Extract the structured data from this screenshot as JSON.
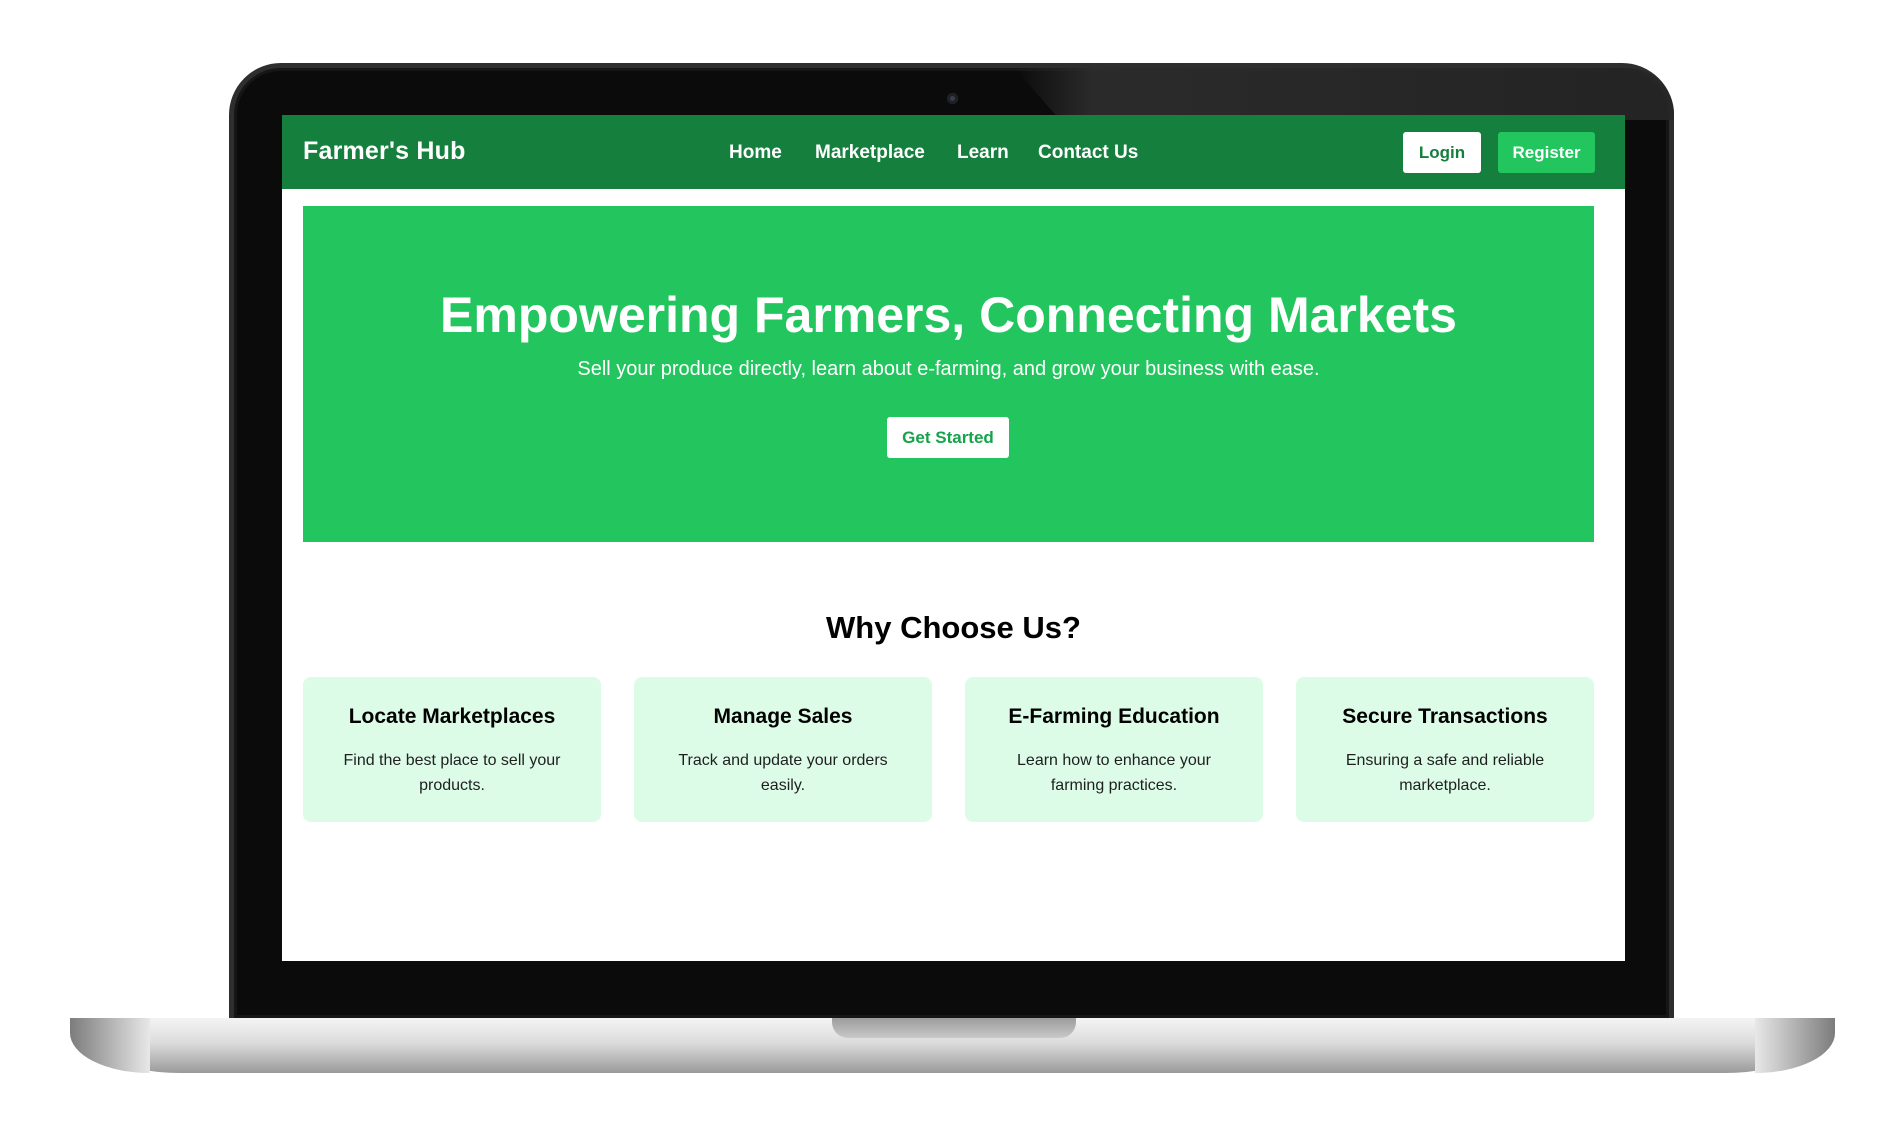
{
  "navbar": {
    "brand": "Farmer's Hub",
    "links": [
      {
        "label": "Home"
      },
      {
        "label": "Marketplace"
      },
      {
        "label": "Learn"
      },
      {
        "label": "Contact Us"
      }
    ],
    "login_label": "Login",
    "register_label": "Register"
  },
  "hero": {
    "title": "Empowering Farmers, Connecting Markets",
    "subtitle": "Sell your produce directly, learn about e-farming, and grow your business with ease.",
    "cta_label": "Get Started"
  },
  "features": {
    "heading": "Why Choose Us?",
    "cards": [
      {
        "title": "Locate Marketplaces",
        "text": "Find the best place to sell your products."
      },
      {
        "title": "Manage Sales",
        "text": "Track and update your orders easily."
      },
      {
        "title": "E-Farming Education",
        "text": "Learn how to enhance your farming practices."
      },
      {
        "title": "Secure Transactions",
        "text": "Ensuring a safe and reliable marketplace."
      }
    ]
  },
  "colors": {
    "nav_bg": "#15803d",
    "hero_bg": "#22c55e",
    "card_bg": "#dcfce7",
    "accent": "#16a34a"
  }
}
